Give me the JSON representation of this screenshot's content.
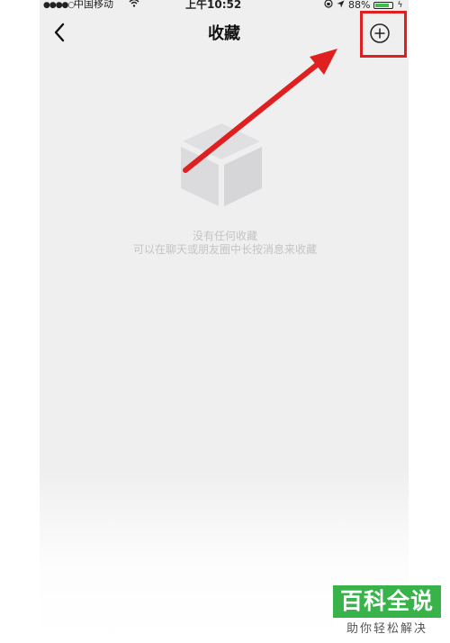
{
  "status_bar": {
    "signal": "●●●●○",
    "carrier": "中国移动",
    "time": "上午10:52",
    "battery_percent": "88%",
    "battery_level": 0.88
  },
  "nav": {
    "title": "收藏"
  },
  "empty_state": {
    "title": "没有任何收藏",
    "hint": "可以在聊天或朋友圈中长按消息来收藏"
  },
  "watermark": {
    "title": "百科全说",
    "subtitle": "助你轻松解决"
  },
  "colors": {
    "annotation": "#e02020",
    "watermark_green": "#38b34a",
    "background": "#efeff0"
  },
  "icons": [
    "chevron-left-icon",
    "add-circle-icon",
    "box-icon",
    "wifi-icon",
    "location-icon",
    "battery-icon"
  ]
}
